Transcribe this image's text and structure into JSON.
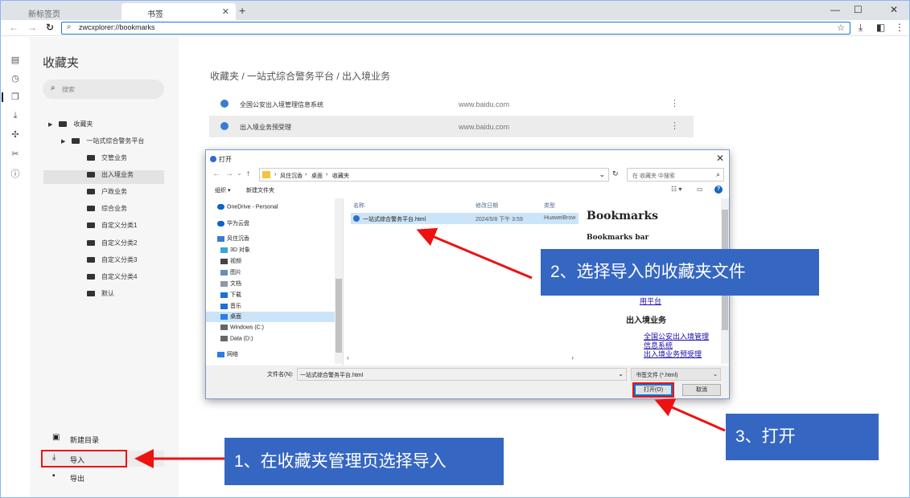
{
  "browser": {
    "tabs": [
      {
        "label": "新标签页",
        "active": false
      },
      {
        "label": "书签",
        "active": true
      }
    ],
    "new_tab": "+",
    "window_controls": [
      "—",
      "☐",
      "✕"
    ],
    "address": "zwcxplorer://bookmarks",
    "accent_color": "#1a73e8"
  },
  "rail_icons": [
    "bookmark-manager-icon",
    "history-icon",
    "collections-icon",
    "download-icon",
    "extensions-icon",
    "tools-icon",
    "info-icon"
  ],
  "panel": {
    "title": "收藏夹",
    "search_placeholder": "搜索",
    "tree": [
      {
        "label": "收藏夹",
        "indent": 0,
        "caret": true
      },
      {
        "label": "一站式综合警务平台",
        "indent": 1,
        "caret": true
      },
      {
        "label": "交管业务",
        "indent": 2
      },
      {
        "label": "出入境业务",
        "indent": 2,
        "selected": true
      },
      {
        "label": "户政业务",
        "indent": 2
      },
      {
        "label": "综合业务",
        "indent": 2
      },
      {
        "label": "自定义分类1",
        "indent": 2
      },
      {
        "label": "自定义分类2",
        "indent": 2
      },
      {
        "label": "自定义分类3",
        "indent": 2
      },
      {
        "label": "自定义分类4",
        "indent": 2
      },
      {
        "label": "默认",
        "indent": 2
      }
    ],
    "new_folder": "新建目录",
    "import": "导入",
    "export": "导出"
  },
  "main": {
    "breadcrumb": "收藏夹 / 一站式综合警务平台 / 出入境业务",
    "bookmarks": [
      {
        "name": "全国公安出入境管理信息系统",
        "url": "www.baidu.com"
      },
      {
        "name": "出入境业务预受理",
        "url": "www.baidu.com"
      }
    ]
  },
  "dialog": {
    "title": "打开",
    "path": [
      "风住沉香",
      "桌面",
      "收藏夹"
    ],
    "search_placeholder": "在 收藏夹 中搜索",
    "organize": "组织 ▾",
    "new_folder": "新建文件夹",
    "nav_items": [
      {
        "label": "OneDrive - Personal",
        "color": "#0a64c8"
      },
      {
        "label": "华为云盘",
        "color": "#0a64c8"
      },
      {
        "label": "风住沉香",
        "color": "#3a7bd5"
      },
      {
        "label": "3D 对象",
        "color": "#36a6d8"
      },
      {
        "label": "视频",
        "color": "#444444"
      },
      {
        "label": "图片",
        "color": "#6a8db8"
      },
      {
        "label": "文档",
        "color": "#8899aa"
      },
      {
        "label": "下载",
        "color": "#1e6fd9"
      },
      {
        "label": "音乐",
        "color": "#1e6fd9"
      },
      {
        "label": "桌面",
        "color": "#2b7de9",
        "selected": true
      },
      {
        "label": "Windows (C:)",
        "color": "#666666"
      },
      {
        "label": "Data (D:)",
        "color": "#666666"
      },
      {
        "label": "网络",
        "color": "#2b7de9"
      }
    ],
    "columns": [
      "名称",
      "修改日期",
      "类型"
    ],
    "file": {
      "name": "一站式综合警务平台.html",
      "date": "2024/5/8 下午 3:59",
      "type": "HuaweiBrow"
    },
    "preview": {
      "h1": "Bookmarks",
      "h2": "Bookmarks bar",
      "link_top": "用平台",
      "section": "出入境业务",
      "links": [
        "全国公安出入境管理",
        "信息系统",
        "出入境业务预受理"
      ]
    },
    "filename_label": "文件名(N):",
    "filename_value": "一站式综合警务平台.html",
    "filetype": "书签文件 (*.html)",
    "open_button": "打开(O)",
    "cancel_button": "取消"
  },
  "callouts": [
    {
      "text": "1、在收藏夹管理页选择导入"
    },
    {
      "text": "2、选择导入的收藏夹文件"
    },
    {
      "text": "3、打开"
    }
  ],
  "highlight_color": "#e11111",
  "callout_color": "#3567c2"
}
